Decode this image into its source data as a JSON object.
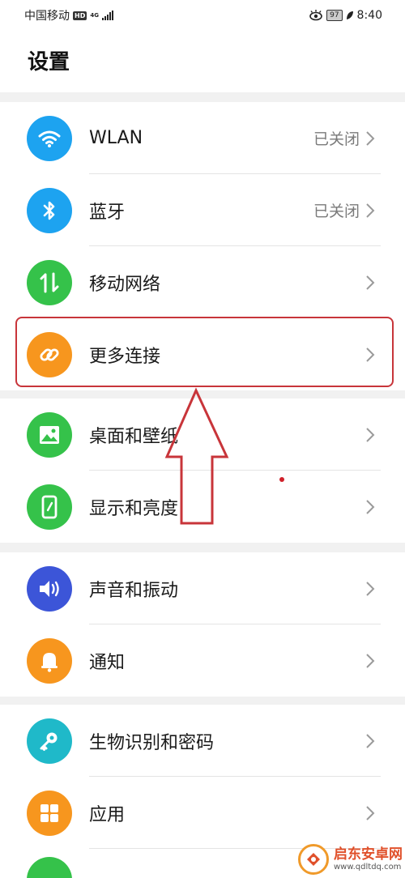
{
  "status_bar": {
    "carrier": "中国移动",
    "hd": "HD",
    "network": "4G",
    "battery": "97",
    "time": "8:40"
  },
  "header": {
    "title": "设置"
  },
  "groups": [
    {
      "items": [
        {
          "label": "WLAN",
          "value": "已关闭",
          "icon": "wifi-icon",
          "color": "#1da3f0"
        },
        {
          "label": "蓝牙",
          "value": "已关闭",
          "icon": "bluetooth-icon",
          "color": "#1da3f0"
        },
        {
          "label": "移动网络",
          "value": "",
          "icon": "mobile-data-icon",
          "color": "#35c24a"
        },
        {
          "label": "更多连接",
          "value": "",
          "icon": "link-icon",
          "color": "#f7961e"
        }
      ]
    },
    {
      "items": [
        {
          "label": "桌面和壁纸",
          "value": "",
          "icon": "wallpaper-icon",
          "color": "#35c24a"
        },
        {
          "label": "显示和亮度",
          "value": "",
          "icon": "display-icon",
          "color": "#35c24a"
        }
      ]
    },
    {
      "items": [
        {
          "label": "声音和振动",
          "value": "",
          "icon": "sound-icon",
          "color": "#3c55d8"
        },
        {
          "label": "通知",
          "value": "",
          "icon": "bell-icon",
          "color": "#f7961e"
        }
      ]
    },
    {
      "items": [
        {
          "label": "生物识别和密码",
          "value": "",
          "icon": "key-icon",
          "color": "#1fb9c9"
        },
        {
          "label": "应用",
          "value": "",
          "icon": "apps-icon",
          "color": "#f7961e"
        }
      ]
    }
  ],
  "watermark": {
    "name": "启东安卓网",
    "url": "www.qdltdq.com"
  },
  "colors": {
    "highlight": "#c8353a",
    "arrow": "#c8353a"
  }
}
